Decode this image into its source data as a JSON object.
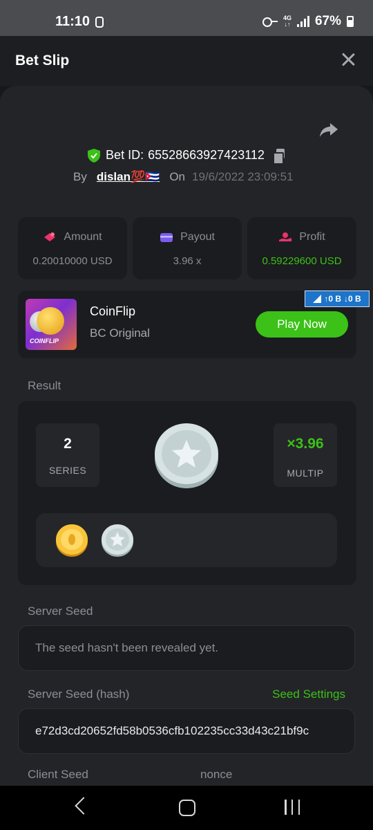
{
  "status_bar": {
    "time": "11:10",
    "network": "4G",
    "battery": "67%"
  },
  "header": {
    "title": "Bet Slip"
  },
  "bet": {
    "id_label": "Bet ID:",
    "id_value": "65528663927423112",
    "by_label": "By",
    "user": "dislan💯🇨🇺",
    "on_label": "On",
    "date": "19/6/2022 23:09:51"
  },
  "stats": {
    "amount": {
      "label": "Amount",
      "value": "0.20010000 USD"
    },
    "payout": {
      "label": "Payout",
      "value": "3.96 x"
    },
    "profit": {
      "label": "Profit",
      "value": "0.59229600 USD"
    }
  },
  "game": {
    "thumb_label": "COINFLIP",
    "title": "CoinFlip",
    "subtitle": "BC Original",
    "play_label": "Play Now"
  },
  "net_badge": {
    "up": "↑0 B",
    "down": "↓0 B"
  },
  "result": {
    "label": "Result",
    "series_value": "2",
    "series_label": "SERIES",
    "multiplier_value": "×3.96",
    "multiplier_label": "MULTIP",
    "history": [
      "gold-coin",
      "silver-coin"
    ]
  },
  "server_seed": {
    "label": "Server Seed",
    "value": "The seed hasn't been revealed yet."
  },
  "server_seed_hash": {
    "label": "Server Seed (hash)",
    "settings_label": "Seed Settings",
    "value": "e72d3cd20652fd58b0536cfb102235cc33d43c21bf9c"
  },
  "client_seed": {
    "label": "Client Seed",
    "nonce_label": "nonce"
  },
  "colors": {
    "accent_green": "#3bc117",
    "background": "#232428",
    "card": "#1b1c1f"
  }
}
